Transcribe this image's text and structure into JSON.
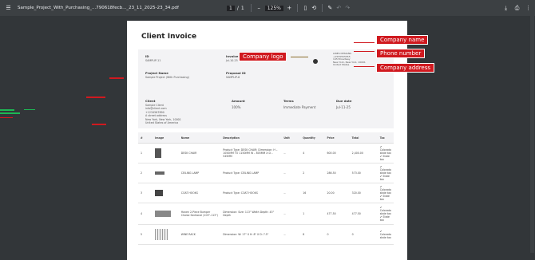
{
  "toolbar": {
    "filename": "Sample_Project_With_Purchasing_...790618fecb..._23_11_2025-23_34.pdf",
    "page_current": "1",
    "page_sep": "/",
    "page_total": "1",
    "zoom": "125%"
  },
  "invoice": {
    "title": "Client Invoice",
    "id_label": "ID",
    "id_value": "SAMPLIP-11",
    "invoice_date_label": "Invoice Date",
    "invoice_date_value": "Jul-10-25",
    "project_name_label": "Project Name",
    "project_name_value": "Sample Project (With Purchasing)",
    "proposal_id_label": "Proposal ID",
    "proposal_id_value": "SAMPLIP-6",
    "company_lines": [
      "LINES DESIGNS",
      "+1555555555",
      "145 Broadway",
      "New York, New York, 10001",
      "United States"
    ],
    "client_label": "Client",
    "client_lines": [
      "Sample Client",
      "info@client.com",
      "+1234567890",
      "A street address",
      "New York, New York, 10001",
      "United States of America"
    ],
    "amount_label": "Amount",
    "amount_value": "100%",
    "terms_label": "Terms",
    "terms_value": "Immediate Payment",
    "due_label": "Due date",
    "due_value": "Jul-11-25"
  },
  "annotations": {
    "company_logo": "Company logo",
    "company_name": "Company name",
    "phone_number": "Phone number",
    "company_address": "Company address"
  },
  "table": {
    "headers": [
      "#",
      "Image",
      "Name",
      "Description",
      "Unit",
      "Quantity",
      "Price",
      "Total",
      "Tax"
    ],
    "rows": [
      [
        "1",
        "",
        "DESK CHAIR",
        "Product Type: DESK CHAIR; Dimension: H – 1050MM TO 1150MM W – 605MM X D – 545MM",
        "--",
        "4",
        "600.00",
        "2,400.00",
        "✔ Colorado state tax ✔ State tax"
      ],
      [
        "2",
        "",
        "CEILING LAMP",
        "Product Type: CEILING LAMP",
        "--",
        "2",
        "286.50",
        "573.00",
        "✔ Colorado state tax ✔ State tax"
      ],
      [
        "3",
        "",
        "COAT HOOKS",
        "Product Type: COAT HOOKS",
        "--",
        "16",
        "20.00",
        "320.00",
        "✔ Colorado state tax ✔ State tax"
      ],
      [
        "4",
        "",
        "Haven 2-Piece Bumper Chaise Sectional (103\"-113\")",
        "Dimension: Size: 113\" Width Depth: 43\" Depth",
        "--",
        "1",
        "477.50",
        "477.50",
        "✔ Colorado state tax ✔ State tax"
      ],
      [
        "5",
        "",
        "WINE RACK",
        "Dimension: W: 17\" X H: 8\" X D: 7.5\"",
        "--",
        "8",
        "0",
        "0",
        "✔ Colorado state tax"
      ]
    ]
  }
}
